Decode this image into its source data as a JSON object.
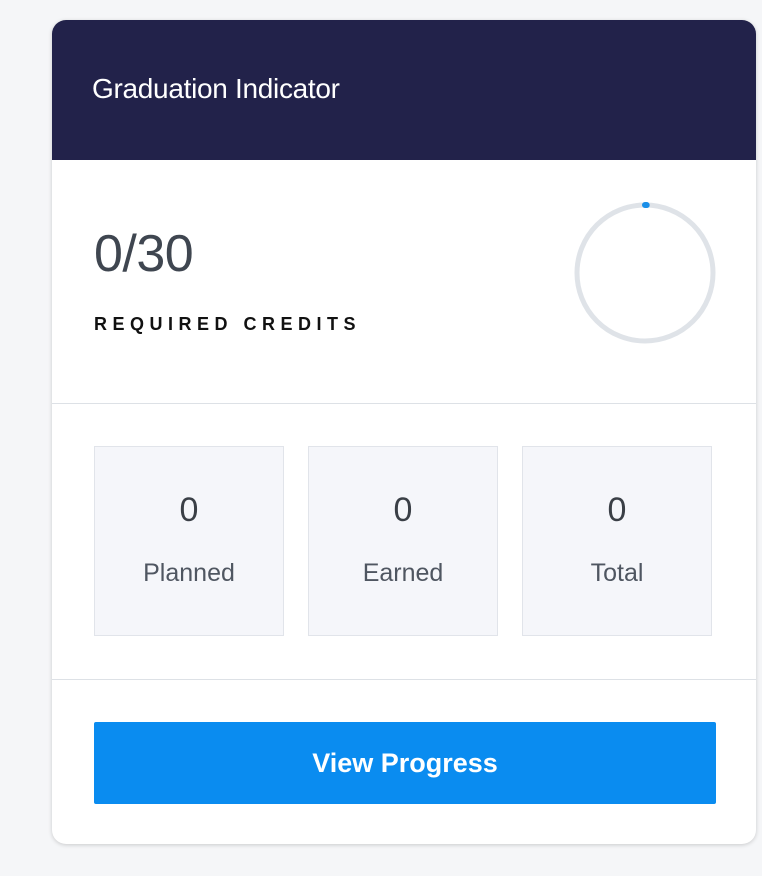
{
  "card": {
    "title": "Graduation Indicator"
  },
  "summary": {
    "credits_value": "0/30",
    "credits_label": "REQUIRED CREDITS",
    "progress_fraction": 0,
    "ring_track_color": "#dfe3e8",
    "ring_progress_color": "#1a8fe8"
  },
  "stats": {
    "planned": {
      "value": "0",
      "label": "Planned"
    },
    "earned": {
      "value": "0",
      "label": "Earned"
    },
    "total": {
      "value": "0",
      "label": "Total"
    }
  },
  "actions": {
    "view_progress_label": "View Progress"
  },
  "colors": {
    "header_bg": "#22224a",
    "button_bg": "#0a8cf0",
    "page_bg": "#f5f6f8"
  }
}
